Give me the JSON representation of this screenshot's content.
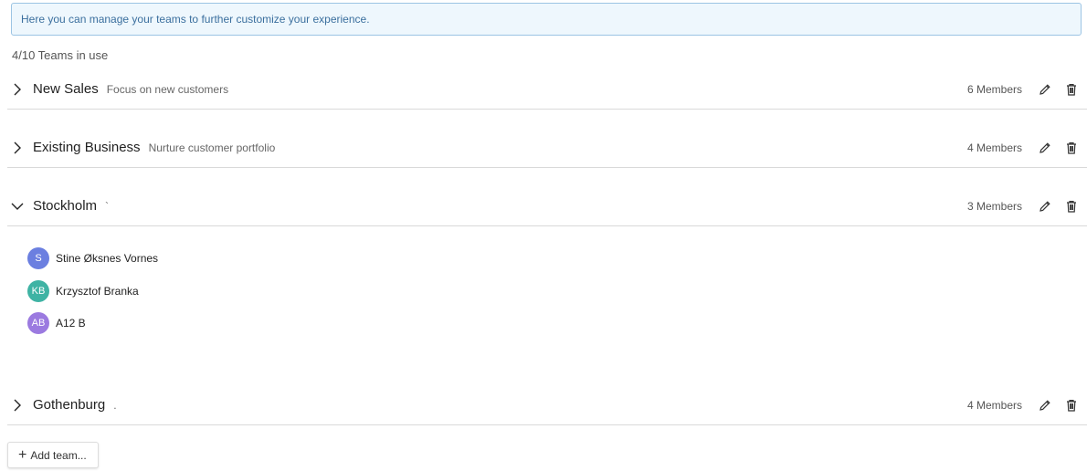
{
  "banner": {
    "text": "Here you can manage your teams to further customize your experience."
  },
  "usage": {
    "text": "4/10 Teams in use"
  },
  "teams": [
    {
      "name": "New Sales",
      "description": "Focus on new customers",
      "members_label": "6 Members",
      "expanded": false
    },
    {
      "name": "Existing Business",
      "description": "Nurture customer portfolio",
      "members_label": "4 Members",
      "expanded": false
    },
    {
      "name": "Stockholm",
      "description": "`",
      "members_label": "3 Members",
      "expanded": true
    },
    {
      "name": "Gothenburg",
      "description": ".",
      "members_label": "4 Members",
      "expanded": false
    }
  ],
  "expanded_members": [
    {
      "initials": "S",
      "name": "Stine Øksnes Vornes",
      "color": "#6b7fe0"
    },
    {
      "initials": "KB",
      "name": "Krzysztof Branka",
      "color": "#3fb3a4"
    },
    {
      "initials": "AB",
      "name": "A12 B",
      "color": "#9b7ae0"
    }
  ],
  "actions": {
    "add_team_label": "Add team..."
  },
  "colors": {
    "banner_bg": "#eef7fd",
    "banner_border": "#9cc4e4",
    "banner_text": "#3b6f9e"
  },
  "icons": {
    "collapsed": "chevron-right-icon",
    "expanded": "chevron-down-icon",
    "edit": "pencil-icon",
    "delete": "trash-icon",
    "add": "plus-icon"
  }
}
